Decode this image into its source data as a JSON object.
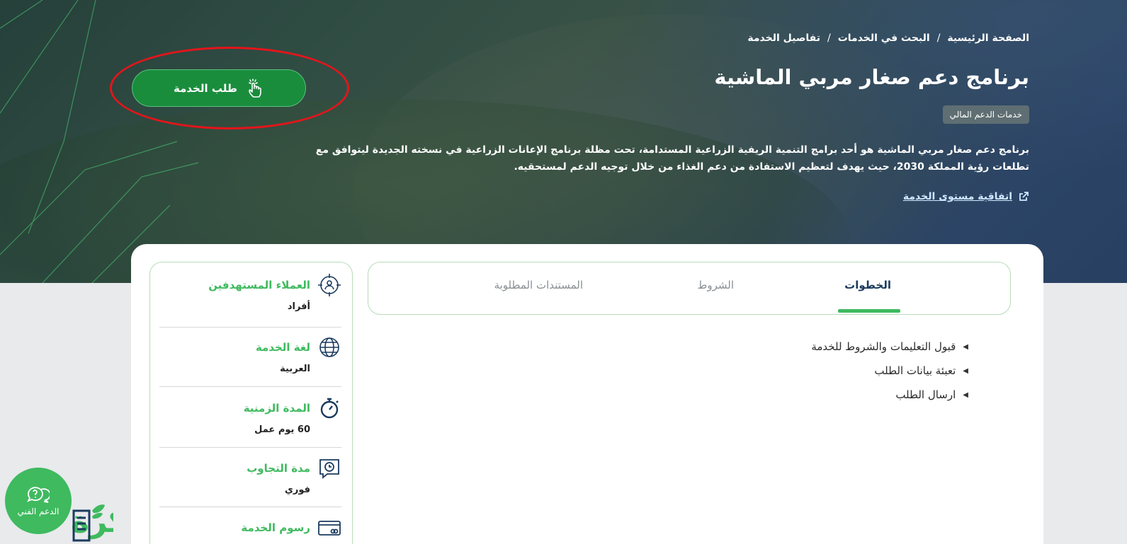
{
  "breadcrumb": {
    "home": "الصفحة الرئيسية",
    "services_search": "البحث في الخدمات",
    "current": "تفاصيل الخدمة",
    "separator": "/"
  },
  "service": {
    "title": "برنامج دعم صغار مربي الماشية",
    "category_badge": "خدمات الدعم المالي",
    "description": "برنامج دعم صغار مربي الماشية هو أحد برامج التنمية الريفية الزراعية المستدامة، تحت مظلة برنامج الإعانات الزراعية في نسخته الجديدة ليتوافق مع تطلعات رؤية المملكة 2030، حيث يهدف لتعظيم الاستفادة من دعم الغذاء من خلال توجيه الدعم لمستحقيه.",
    "sla_link": "اتفاقية مستوى الخدمة",
    "request_button": "طلب الخدمة"
  },
  "tabs": [
    {
      "label": "الخطوات",
      "active": true
    },
    {
      "label": "الشروط",
      "active": false
    },
    {
      "label": "المستندات المطلوبة",
      "active": false
    }
  ],
  "steps": [
    "قبول التعليمات والشروط للخدمة",
    "تعبئة بيانات الطلب",
    "ارسال الطلب"
  ],
  "info": [
    {
      "label": "العملاء المستهدفين",
      "value": "أفراد",
      "icon": "target-user-icon"
    },
    {
      "label": "لغة الخدمة",
      "value": "العربية",
      "icon": "globe-icon"
    },
    {
      "label": "المدة الزمنية",
      "value": "60 يوم عمل",
      "icon": "stopwatch-icon"
    },
    {
      "label": "مدة التجاوب",
      "value": "فوري",
      "icon": "clock-chat-icon"
    },
    {
      "label": "رسوم الخدمة",
      "value": "",
      "icon": "credit-card-icon"
    }
  ],
  "support": {
    "label": "الدعم الفني"
  },
  "watermark": "فكرة",
  "colors": {
    "green": "#1a8d3d",
    "accent": "#3fba5f",
    "navy": "#1b3b5e",
    "highlight": "#e3151b"
  }
}
